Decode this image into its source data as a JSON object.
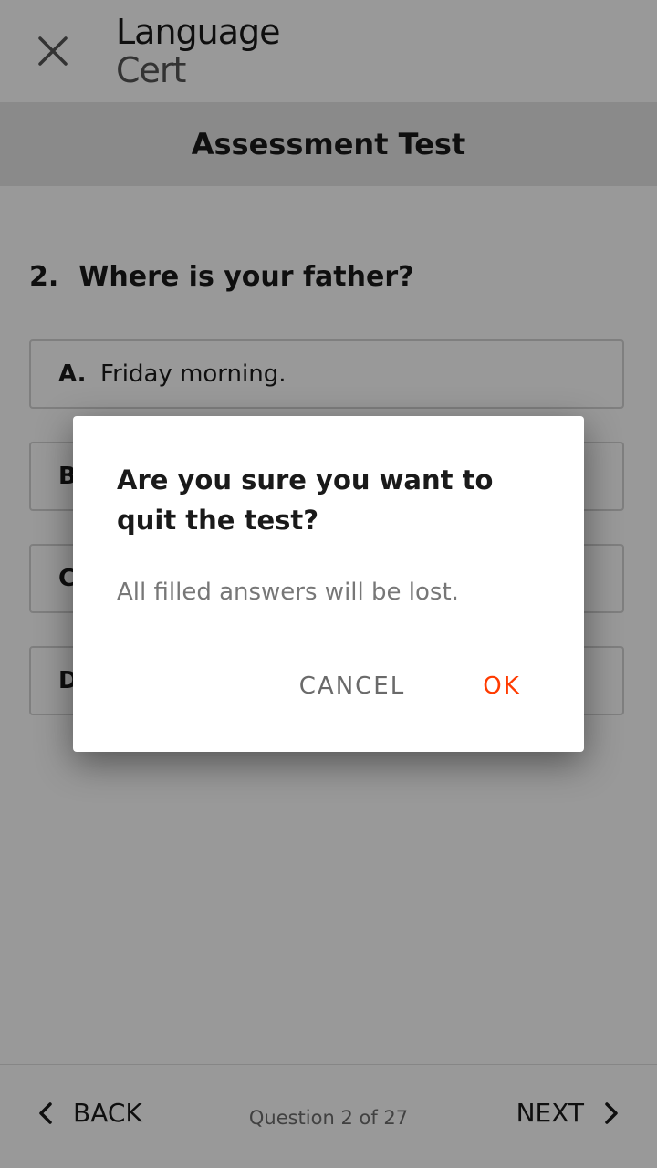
{
  "header": {
    "logo_line1": "Language",
    "logo_line2": "Cert",
    "title": "Assessment Test"
  },
  "question": {
    "number": "2.",
    "text": "Where is your father?",
    "options": [
      {
        "letter": "A.",
        "text": "Friday morning."
      },
      {
        "letter": "B",
        "text": ""
      },
      {
        "letter": "C",
        "text": ""
      },
      {
        "letter": "D",
        "text": ""
      }
    ]
  },
  "footer": {
    "back_label": "BACK",
    "progress": "Question 2 of 27",
    "next_label": "NEXT"
  },
  "dialog": {
    "title": "Are you sure you want to quit the test?",
    "message": "All filled answers will be lost.",
    "cancel_label": "CANCEL",
    "ok_label": "OK"
  },
  "colors": {
    "accent": "#ff3b00",
    "header_band": "#e6e6e6"
  },
  "icons": {
    "close": "close-icon",
    "back": "chevron-left-icon",
    "next": "chevron-right-icon"
  }
}
